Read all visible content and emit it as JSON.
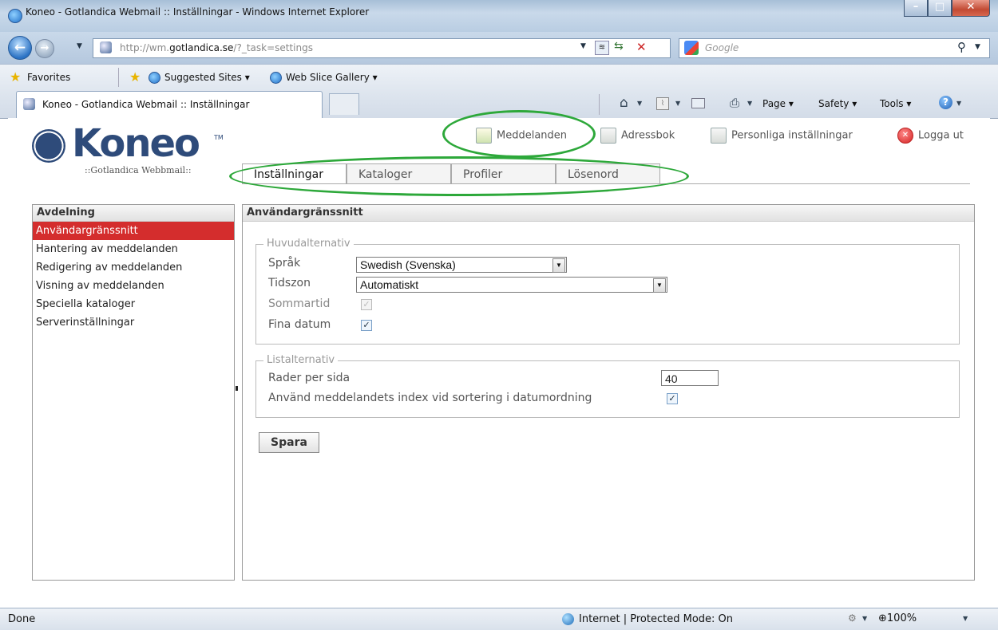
{
  "browser": {
    "title": "Koneo - Gotlandica Webmail :: Inställningar - Windows Internet Explorer",
    "url_prefix": "http://wm.",
    "url_domain": "gotlandica.se",
    "url_path": "/?_task=settings",
    "search_placeholder": "Google",
    "favorites_label": "Favorites",
    "suggested_sites": "Suggested Sites ▾",
    "web_slice_gallery": "Web Slice Gallery ▾",
    "tab_title": "Koneo - Gotlandica Webmail :: Inställningar",
    "cmd_page": "Page ▾",
    "cmd_safety": "Safety ▾",
    "cmd_tools": "Tools ▾",
    "status_done": "Done",
    "status_zone": "Internet | Protected Mode: On",
    "zoom": "100%"
  },
  "app": {
    "logo_text": "Koneo",
    "logo_tm": "TM",
    "logo_sub": "::Gotlandica Webbmail::",
    "top_links": {
      "messages": "Meddelanden",
      "addressbook": "Adressbok",
      "personal_settings": "Personliga inställningar",
      "logout": "Logga ut"
    },
    "tabs": [
      "Inställningar",
      "Kataloger",
      "Profiler",
      "Lösenord"
    ],
    "sidebar": {
      "heading": "Avdelning",
      "items": [
        "Användargränssnitt",
        "Hantering av meddelanden",
        "Redigering av meddelanden",
        "Visning av meddelanden",
        "Speciella kataloger",
        "Serverinställningar"
      ],
      "selected_index": 0
    },
    "main": {
      "heading": "Användargränssnitt",
      "main_options": {
        "legend": "Huvudalternativ",
        "language_label": "Språk",
        "language_value": "Swedish (Svenska)",
        "timezone_label": "Tidszon",
        "timezone_value": "Automatiskt",
        "dst_label": "Sommartid",
        "dst_checked": true,
        "dst_disabled": true,
        "pretty_dates_label": "Fina datum",
        "pretty_dates_checked": true
      },
      "list_options": {
        "legend": "Listalternativ",
        "rows_label": "Rader per sida",
        "rows_value": "40",
        "index_sort_label": "Använd meddelandets index vid sortering i datumordning",
        "index_sort_checked": true
      },
      "save_label": "Spara"
    }
  },
  "colors": {
    "highlight_oval": "#2da83a",
    "selected_nav": "#d42d2d",
    "logo": "#2e4b7a"
  }
}
